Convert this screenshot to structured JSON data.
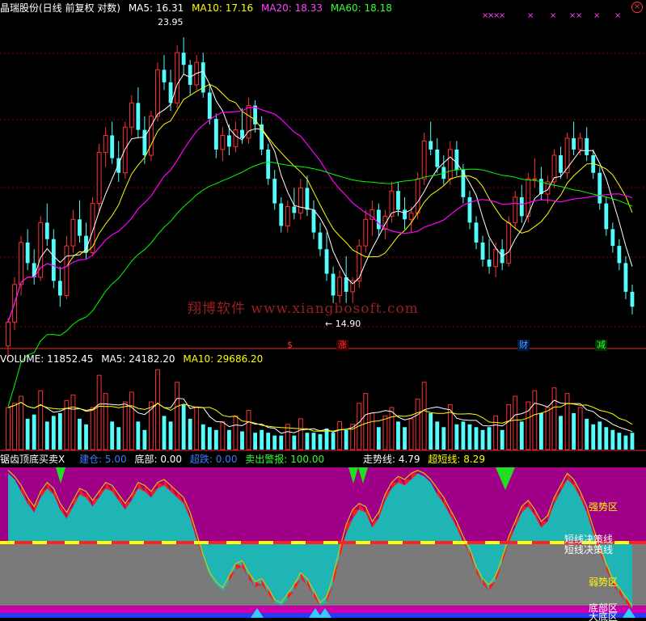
{
  "colors": {
    "background": "#000000",
    "up": "#ff3232",
    "down": "#54fcfc",
    "ma5": "#ffffff",
    "ma10": "#ffff00",
    "ma20": "#ff00ff",
    "ma60": "#00ff00",
    "strong_zone": "#a00088",
    "weak_zone": "#7a7a7a",
    "bottom_zone": "#00b0ff"
  },
  "price_panel": {
    "title": "晶瑞股份(日线 前复权 对数)",
    "ma5_label": "MA5: 16.31",
    "ma10_label": "MA10: 17.16",
    "ma20_label": "MA20: 18.33",
    "ma60_label": "MA60: 18.18",
    "high_label": "23.95",
    "low_label": "14.90",
    "watermark": "翔博软件 www.xiangbosoft.com",
    "close_icon": "close-icon",
    "signals": [
      {
        "text": "$",
        "color": "#ff3232"
      },
      {
        "text": "涨",
        "color": "#ff3232"
      },
      {
        "text": "财",
        "color": "#5599ff"
      },
      {
        "text": "减",
        "color": "#33ff33"
      }
    ]
  },
  "volume_panel": {
    "volume_label": "VOLUME: 11852.45",
    "ma5_label": "MA5: 24182.20",
    "ma10_label": "MA10: 29686.20"
  },
  "indicator_panel": {
    "name": "锯齿顶底买卖X",
    "items": [
      {
        "label": "建仓: 5.00",
        "color": "#3c78ff"
      },
      {
        "label": "底部: 0.00",
        "color": "#ffffff"
      },
      {
        "label": "超跌: 0.00",
        "color": "#3c78ff"
      },
      {
        "label": "卖出警报: 100.00",
        "color": "#33ff33"
      },
      {
        "label": "走势线: 4.79",
        "color": "#ffffff"
      },
      {
        "label": "超短线: 8.29",
        "color": "#ffff00"
      }
    ],
    "zones": {
      "strong": "强势区",
      "line1": "短线决策线",
      "line2": "短线决策线",
      "weak": "弱势区",
      "bottom": "底部区",
      "big_bottom": "大底区"
    }
  },
  "chart_data": {
    "type": "candlestick",
    "price_axis": {
      "min": 14.2,
      "max": 24.8,
      "scale": "log"
    },
    "volume_axis": {
      "min": 0,
      "max": 60000
    },
    "indicator_axis": {
      "min": 0,
      "max": 100,
      "decision_line": 50
    },
    "candles": [
      [
        13.8,
        14.5,
        13.5,
        14.4
      ],
      [
        14.4,
        15.6,
        14.2,
        15.4
      ],
      [
        15.4,
        16.8,
        15.1,
        16.6
      ],
      [
        16.6,
        17.0,
        15.8,
        16.0
      ],
      [
        16.0,
        16.4,
        15.4,
        15.6
      ],
      [
        15.6,
        17.4,
        15.5,
        17.2
      ],
      [
        17.2,
        17.8,
        16.5,
        16.7
      ],
      [
        16.7,
        17.0,
        15.3,
        15.5
      ],
      [
        15.5,
        15.9,
        14.8,
        15.1
      ],
      [
        15.1,
        16.8,
        15.0,
        16.5
      ],
      [
        16.5,
        17.6,
        16.3,
        17.3
      ],
      [
        17.3,
        17.9,
        16.6,
        16.8
      ],
      [
        16.8,
        17.2,
        16.1,
        16.3
      ],
      [
        16.3,
        18.0,
        16.2,
        17.8
      ],
      [
        17.8,
        19.8,
        17.5,
        19.5
      ],
      [
        19.5,
        20.4,
        19.0,
        20.1
      ],
      [
        20.1,
        20.6,
        19.1,
        19.3
      ],
      [
        19.3,
        19.9,
        18.5,
        18.8
      ],
      [
        18.8,
        20.6,
        18.6,
        20.4
      ],
      [
        20.4,
        21.6,
        20.1,
        21.3
      ],
      [
        21.3,
        21.9,
        20.0,
        20.3
      ],
      [
        20.3,
        20.8,
        19.1,
        19.4
      ],
      [
        19.4,
        21.0,
        19.2,
        20.8
      ],
      [
        20.8,
        22.9,
        20.6,
        22.6
      ],
      [
        22.6,
        23.2,
        21.8,
        22.1
      ],
      [
        22.1,
        22.6,
        21.0,
        21.3
      ],
      [
        21.3,
        23.6,
        21.1,
        23.3
      ],
      [
        23.3,
        23.95,
        22.4,
        22.8
      ],
      [
        22.8,
        23.0,
        21.6,
        22.0
      ],
      [
        22.0,
        23.2,
        21.8,
        22.9
      ],
      [
        22.9,
        23.3,
        21.5,
        21.7
      ],
      [
        21.7,
        22.0,
        20.5,
        20.7
      ],
      [
        20.7,
        20.9,
        19.3,
        19.6
      ],
      [
        19.6,
        20.4,
        19.2,
        20.1
      ],
      [
        20.1,
        20.5,
        19.4,
        19.7
      ],
      [
        19.7,
        20.6,
        19.5,
        20.3
      ],
      [
        20.3,
        21.1,
        19.8,
        20.0
      ],
      [
        20.0,
        21.5,
        19.8,
        21.2
      ],
      [
        21.2,
        21.4,
        20.2,
        20.5
      ],
      [
        20.5,
        20.8,
        19.4,
        19.6
      ],
      [
        19.6,
        19.8,
        18.4,
        18.6
      ],
      [
        18.6,
        18.9,
        17.6,
        17.8
      ],
      [
        17.8,
        18.0,
        16.9,
        17.1
      ],
      [
        17.1,
        17.9,
        16.9,
        17.7
      ],
      [
        17.7,
        18.3,
        17.3,
        17.5
      ],
      [
        17.5,
        18.6,
        17.3,
        18.3
      ],
      [
        18.3,
        18.7,
        17.4,
        17.6
      ],
      [
        17.6,
        17.9,
        16.7,
        16.9
      ],
      [
        16.9,
        17.2,
        16.2,
        16.4
      ],
      [
        16.4,
        16.9,
        15.5,
        15.7
      ],
      [
        15.7,
        15.9,
        14.9,
        15.1
      ],
      [
        15.1,
        15.8,
        14.9,
        15.6
      ],
      [
        15.6,
        16.2,
        14.9,
        15.2
      ],
      [
        15.2,
        15.6,
        14.9,
        15.5
      ],
      [
        15.5,
        16.7,
        15.3,
        16.5
      ],
      [
        16.5,
        17.6,
        16.3,
        17.3
      ],
      [
        17.3,
        17.9,
        16.8,
        17.6
      ],
      [
        17.6,
        17.8,
        16.8,
        17.0
      ],
      [
        17.0,
        17.6,
        16.7,
        17.4
      ],
      [
        17.4,
        18.5,
        17.2,
        18.2
      ],
      [
        18.2,
        18.5,
        17.4,
        17.6
      ],
      [
        17.6,
        18.0,
        17.0,
        17.3
      ],
      [
        17.3,
        17.7,
        16.9,
        17.5
      ],
      [
        17.5,
        18.8,
        17.3,
        18.6
      ],
      [
        18.6,
        20.2,
        18.4,
        19.9
      ],
      [
        19.9,
        20.6,
        19.4,
        19.6
      ],
      [
        19.6,
        20.0,
        18.8,
        19.0
      ],
      [
        19.0,
        19.4,
        18.4,
        18.6
      ],
      [
        18.6,
        19.9,
        18.4,
        19.6
      ],
      [
        19.6,
        19.9,
        18.7,
        18.9
      ],
      [
        18.9,
        19.1,
        17.8,
        18.0
      ],
      [
        18.0,
        18.2,
        17.0,
        17.2
      ],
      [
        17.2,
        17.4,
        16.4,
        16.6
      ],
      [
        16.6,
        16.8,
        15.9,
        16.1
      ],
      [
        16.1,
        16.7,
        15.7,
        15.9
      ],
      [
        15.9,
        16.6,
        15.6,
        16.4
      ],
      [
        16.4,
        16.7,
        15.8,
        16.0
      ],
      [
        16.0,
        17.4,
        15.9,
        17.2
      ],
      [
        17.2,
        18.2,
        17.0,
        18.0
      ],
      [
        18.0,
        18.4,
        17.2,
        17.4
      ],
      [
        17.4,
        18.8,
        17.2,
        18.6
      ],
      [
        18.6,
        19.3,
        18.3,
        18.6
      ],
      [
        18.6,
        19.0,
        17.9,
        18.1
      ],
      [
        18.1,
        18.7,
        17.8,
        18.5
      ],
      [
        18.5,
        19.6,
        18.3,
        19.4
      ],
      [
        19.4,
        19.7,
        18.6,
        18.8
      ],
      [
        18.8,
        20.2,
        18.6,
        20.0
      ],
      [
        20.0,
        20.6,
        19.4,
        19.6
      ],
      [
        19.6,
        20.2,
        19.4,
        20.0
      ],
      [
        20.0,
        20.4,
        19.2,
        19.4
      ],
      [
        19.4,
        19.6,
        18.6,
        18.8
      ],
      [
        18.8,
        19.0,
        17.6,
        17.8
      ],
      [
        17.8,
        18.0,
        16.8,
        17.0
      ],
      [
        17.0,
        17.2,
        16.3,
        16.5
      ],
      [
        16.5,
        16.7,
        15.8,
        16.0
      ],
      [
        16.0,
        16.2,
        15.0,
        15.2
      ],
      [
        15.2,
        15.4,
        14.6,
        14.8
      ]
    ],
    "volumes": [
      [
        30000,
        1
      ],
      [
        33000,
        1
      ],
      [
        38000,
        1
      ],
      [
        22000,
        0
      ],
      [
        25000,
        0
      ],
      [
        42000,
        1
      ],
      [
        20000,
        0
      ],
      [
        24000,
        0
      ],
      [
        26000,
        0
      ],
      [
        35000,
        1
      ],
      [
        39000,
        1
      ],
      [
        22000,
        0
      ],
      [
        18000,
        0
      ],
      [
        30000,
        1
      ],
      [
        53000,
        1
      ],
      [
        40000,
        1
      ],
      [
        20000,
        0
      ],
      [
        16000,
        0
      ],
      [
        34000,
        1
      ],
      [
        41000,
        1
      ],
      [
        20000,
        0
      ],
      [
        14000,
        0
      ],
      [
        34000,
        1
      ],
      [
        57000,
        1
      ],
      [
        24000,
        0
      ],
      [
        20000,
        0
      ],
      [
        48000,
        1
      ],
      [
        32000,
        0
      ],
      [
        22000,
        0
      ],
      [
        30000,
        1
      ],
      [
        18000,
        0
      ],
      [
        16000,
        0
      ],
      [
        14000,
        0
      ],
      [
        20000,
        1
      ],
      [
        14000,
        0
      ],
      [
        24000,
        1
      ],
      [
        13000,
        0
      ],
      [
        28000,
        1
      ],
      [
        12000,
        0
      ],
      [
        14000,
        0
      ],
      [
        12000,
        0
      ],
      [
        10000,
        0
      ],
      [
        10000,
        0
      ],
      [
        18000,
        1
      ],
      [
        10000,
        0
      ],
      [
        22000,
        1
      ],
      [
        12000,
        0
      ],
      [
        12000,
        0
      ],
      [
        11000,
        0
      ],
      [
        15000,
        0
      ],
      [
        12000,
        0
      ],
      [
        20000,
        1
      ],
      [
        14000,
        0
      ],
      [
        18000,
        1
      ],
      [
        33000,
        1
      ],
      [
        40000,
        1
      ],
      [
        26000,
        1
      ],
      [
        16000,
        0
      ],
      [
        24000,
        1
      ],
      [
        30000,
        1
      ],
      [
        20000,
        0
      ],
      [
        16000,
        0
      ],
      [
        22000,
        1
      ],
      [
        36000,
        1
      ],
      [
        48000,
        1
      ],
      [
        26000,
        0
      ],
      [
        20000,
        0
      ],
      [
        16000,
        0
      ],
      [
        32000,
        1
      ],
      [
        18000,
        0
      ],
      [
        20000,
        0
      ],
      [
        18000,
        0
      ],
      [
        16000,
        0
      ],
      [
        14000,
        0
      ],
      [
        16000,
        0
      ],
      [
        24000,
        1
      ],
      [
        14000,
        0
      ],
      [
        32000,
        1
      ],
      [
        38000,
        1
      ],
      [
        20000,
        0
      ],
      [
        34000,
        1
      ],
      [
        42000,
        1
      ],
      [
        26000,
        0
      ],
      [
        30000,
        1
      ],
      [
        44000,
        1
      ],
      [
        24000,
        0
      ],
      [
        40000,
        1
      ],
      [
        26000,
        0
      ],
      [
        30000,
        1
      ],
      [
        22000,
        0
      ],
      [
        18000,
        0
      ],
      [
        20000,
        0
      ],
      [
        16000,
        0
      ],
      [
        14000,
        0
      ],
      [
        12000,
        0
      ],
      [
        10000,
        0
      ],
      [
        12000,
        0
      ]
    ],
    "indicator": {
      "trend_line": [
        96,
        92,
        84,
        76,
        70,
        80,
        86,
        82,
        72,
        66,
        74,
        82,
        80,
        74,
        80,
        86,
        84,
        78,
        72,
        78,
        86,
        84,
        80,
        86,
        88,
        84,
        80,
        76,
        66,
        52,
        40,
        28,
        22,
        18,
        24,
        32,
        34,
        26,
        20,
        22,
        16,
        10,
        8,
        12,
        18,
        26,
        22,
        14,
        8,
        10,
        22,
        40,
        56,
        66,
        72,
        70,
        60,
        66,
        78,
        86,
        90,
        88,
        92,
        96,
        94,
        90,
        82,
        76,
        68,
        60,
        50,
        42,
        30,
        22,
        18,
        24,
        36,
        50,
        60,
        70,
        74,
        68,
        60,
        64,
        76,
        84,
        92,
        88,
        80,
        70,
        56,
        44,
        32,
        22,
        16,
        10,
        6
      ],
      "short_line": [
        98,
        94,
        88,
        80,
        74,
        84,
        90,
        86,
        76,
        70,
        78,
        86,
        84,
        78,
        84,
        90,
        88,
        82,
        76,
        82,
        90,
        88,
        84,
        90,
        92,
        88,
        84,
        80,
        70,
        56,
        42,
        30,
        24,
        20,
        28,
        36,
        38,
        30,
        24,
        26,
        20,
        12,
        10,
        16,
        22,
        30,
        26,
        18,
        10,
        14,
        28,
        46,
        62,
        72,
        76,
        74,
        64,
        70,
        82,
        90,
        94,
        92,
        96,
        98,
        96,
        92,
        86,
        80,
        72,
        64,
        54,
        46,
        34,
        26,
        22,
        28,
        40,
        54,
        64,
        74,
        78,
        72,
        64,
        68,
        80,
        88,
        96,
        92,
        84,
        74,
        60,
        48,
        36,
        26,
        20,
        14,
        8
      ]
    }
  }
}
